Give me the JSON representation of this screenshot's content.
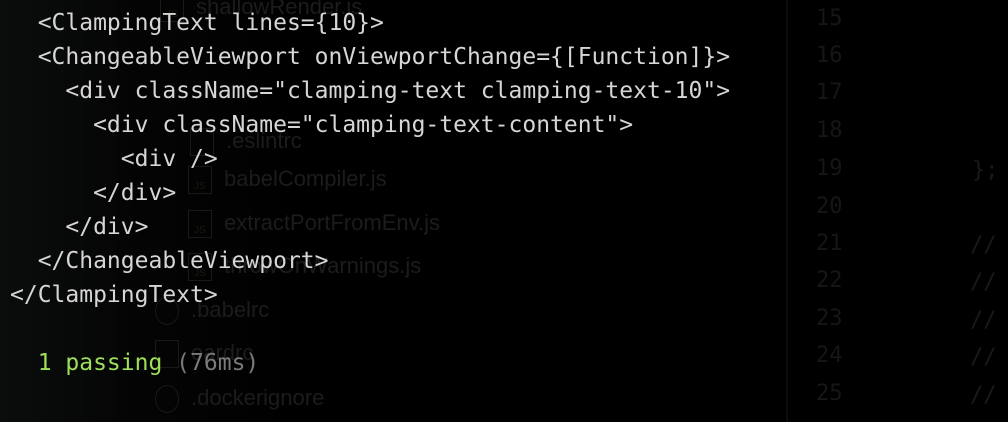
{
  "terminal": {
    "lines": [
      "  <ClampingText lines={10}>",
      "  <ChangeableViewport onViewportChange={[Function]}>",
      "    <div className=\"clamping-text clamping-text-10\">",
      "      <div className=\"clamping-text-content\">",
      "        <div />",
      "      </div>",
      "    </div>",
      "  </ChangeableViewport>",
      "</ClampingText>"
    ],
    "result_count": "  1 passing",
    "result_duration": " (76ms)",
    "colors": {
      "text": "#d6d6d6",
      "passing": "#9ee05a",
      "duration": "#7a7a7a"
    }
  },
  "background_editor": {
    "files": [
      "shallowRender.js",
      ".eslintrc",
      "babelCompiler.js",
      "extractPortFromEnv.js",
      "throwOnWarnings.js",
      ".babelrc",
      "oardrc",
      ".dockerignore"
    ],
    "line_numbers": [
      "15",
      "16",
      "17",
      "18",
      "19",
      "20",
      "21",
      "22",
      "23",
      "24",
      "25"
    ],
    "code_fragments": [
      "};",
      "//",
      "//",
      "//",
      "//",
      "//"
    ]
  }
}
